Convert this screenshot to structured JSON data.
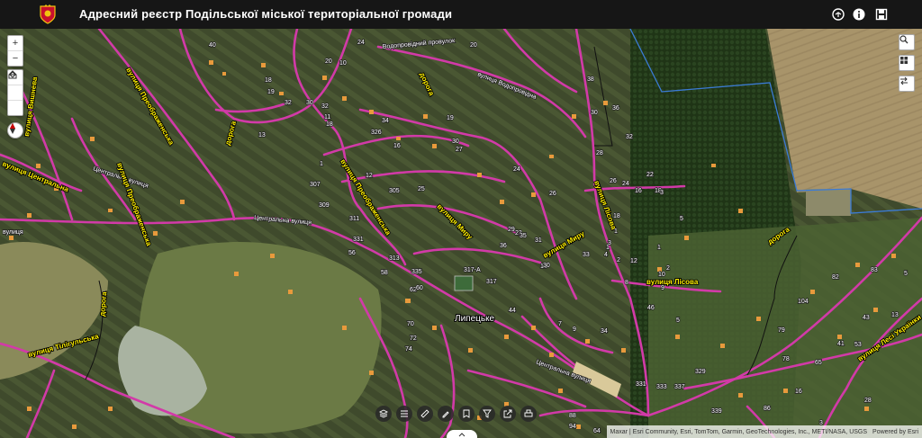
{
  "header": {
    "title": "Адресний реєстр Подільської міської територіальної громади",
    "buttons": [
      "sharing-icon",
      "info-icon",
      "save-icon"
    ]
  },
  "controls": {
    "zoom_in": "+",
    "zoom_out": "−"
  },
  "map": {
    "place_label": "Липецьке",
    "streets": {
      "vyshneva": "вулиця Вишнева",
      "tsentralna_left": "вулиця Центральна",
      "tsentralna_small": "Центральна вулиця",
      "tsentralna_small2": "Центральна вулиця",
      "vulytsia": "вулиця",
      "pereobrazhenska1": "вулиця Преображенська",
      "pereobrazhenska2": "вулиця Преображенська",
      "pereobrazhenska3": "вулиця Преображенська",
      "vodoprovidnyi": "Водопровідний провулок",
      "vodoprovidna": "вулиця Водопровідна",
      "dorohha1": "дорога",
      "dorohha2": "дорога",
      "dorohha3": "дорога",
      "myru1": "вулиця Миру",
      "myru2": "вулиця Миру",
      "lisova1": "вулиця Лісова",
      "lisova2": "вулиця Лісова",
      "tiligulska": "вулиця Тілігульська",
      "lesi": "вулиця Лесі Українки",
      "tsentralna_bottom": "Центральна вулиця",
      "dorohha4": "дорога"
    },
    "numbers": [
      "40",
      "24",
      "20",
      "10",
      "18",
      "32",
      "30",
      "19",
      "32",
      "11",
      "18",
      "13",
      "326",
      "34",
      "16",
      "1",
      "12",
      "19",
      "30",
      "36",
      "38",
      "20",
      "32",
      "30",
      "22",
      "26",
      "24",
      "28",
      "16",
      "18",
      "26",
      "307",
      "309",
      "311",
      "331",
      "305",
      "25",
      "27",
      "24",
      "23",
      "31",
      "13",
      "29",
      "35",
      "36",
      "33",
      "30",
      "1",
      "10",
      "9",
      "2",
      "8",
      "4",
      "3",
      "2",
      "313",
      "56",
      "58",
      "62",
      "60",
      "70",
      "72",
      "74",
      "335",
      "317-А",
      "317",
      "44",
      "46",
      "5",
      "7",
      "9",
      "34",
      "104",
      "329",
      "331",
      "333",
      "337",
      "339",
      "86",
      "88",
      "94",
      "64",
      "43",
      "41",
      "53",
      "28",
      "83",
      "82",
      "79",
      "78",
      "65",
      "16",
      "3",
      "5",
      "13",
      "1",
      "1",
      "5",
      "3",
      "12",
      "18"
    ]
  },
  "attribution": {
    "sources": "Maxar | Esri Community, Esri, TomTom, Garmin, GeoTechnologies, Inc., METI/NASA, USGS",
    "powered": "Powered by Esri"
  }
}
